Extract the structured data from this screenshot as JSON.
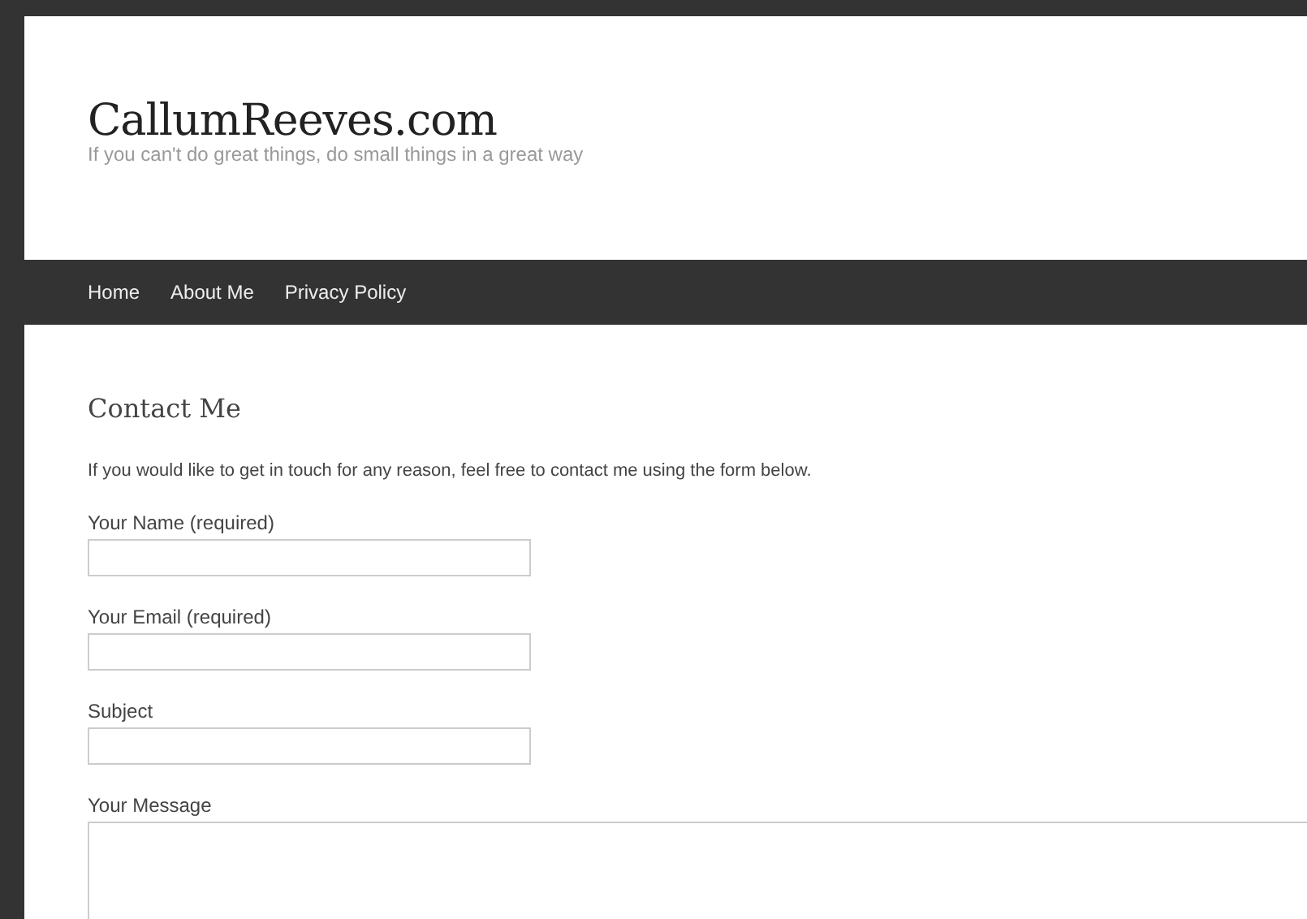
{
  "site": {
    "title": "CallumReeves.com",
    "tagline": "If you can't do great things, do small things in a great way"
  },
  "nav": {
    "items": [
      {
        "label": "Home"
      },
      {
        "label": "About Me"
      },
      {
        "label": "Privacy Policy"
      }
    ]
  },
  "page": {
    "heading": "Contact Me",
    "intro": "If you would like to get in touch for any reason, feel free to contact me using the form below."
  },
  "form": {
    "fields": [
      {
        "label": "Your Name (required)",
        "kind": "input"
      },
      {
        "label": "Your Email (required)",
        "kind": "input"
      },
      {
        "label": "Subject",
        "kind": "input"
      },
      {
        "label": "Your Message",
        "kind": "textarea"
      }
    ]
  }
}
